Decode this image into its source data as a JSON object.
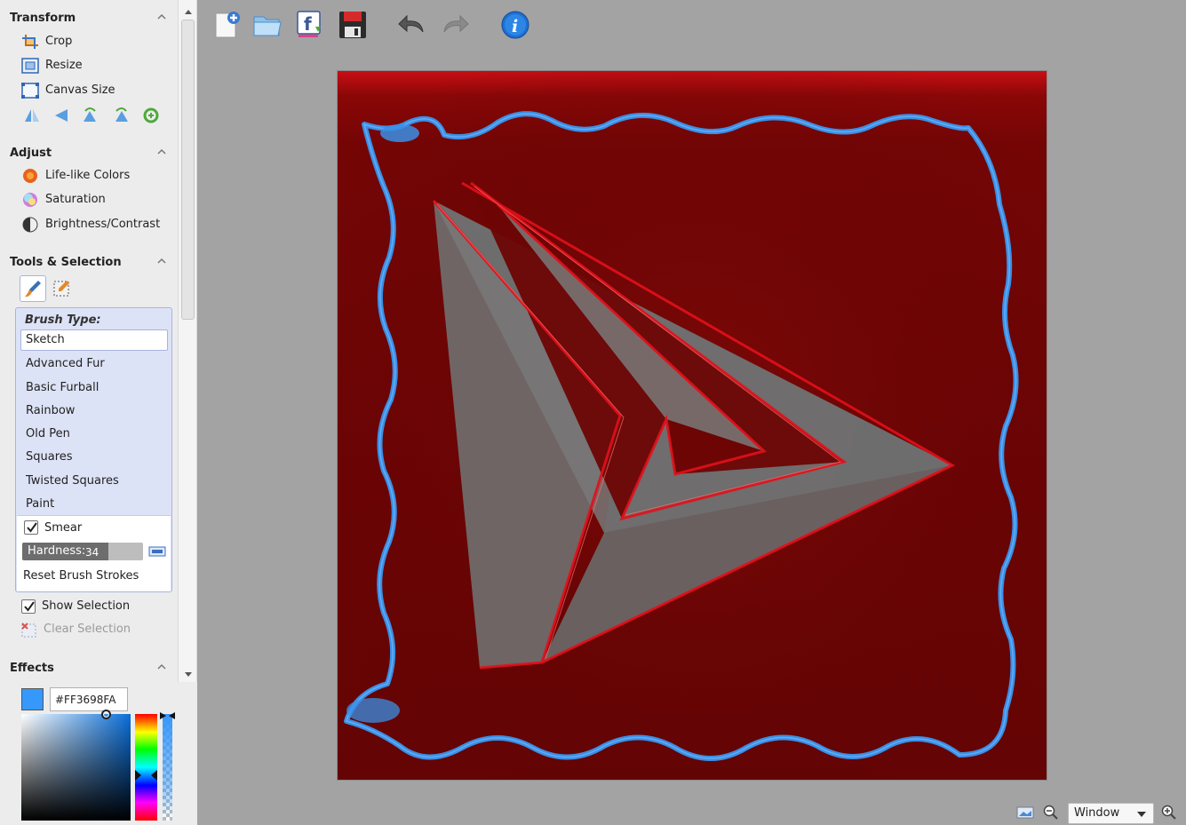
{
  "sidebar": {
    "transform": {
      "title": "Transform",
      "items": [
        {
          "label": "Crop",
          "icon": "crop-icon"
        },
        {
          "label": "Resize",
          "icon": "resize-icon"
        },
        {
          "label": "Canvas Size",
          "icon": "canvas-size-icon"
        }
      ],
      "tools": [
        "flip-vertical-icon",
        "flip-horizontal-icon",
        "rotate-left-icon",
        "rotate-right-icon",
        "rotate-free-icon"
      ]
    },
    "adjust": {
      "title": "Adjust",
      "items": [
        {
          "label": "Life-like Colors",
          "icon": "life-like-colors-icon"
        },
        {
          "label": "Saturation",
          "icon": "saturation-icon"
        },
        {
          "label": "Brightness/Contrast",
          "icon": "brightness-contrast-icon"
        }
      ]
    },
    "tools": {
      "title": "Tools & Selection",
      "tabs": [
        "brush-tool-icon",
        "selection-tool-icon"
      ],
      "brush_type_label": "Brush Type:",
      "brush_types": [
        "Sketch",
        "Advanced Fur",
        "Basic Furball",
        "Rainbow",
        "Old Pen",
        "Squares",
        "Twisted Squares",
        "Paint"
      ],
      "selected_brush": "Sketch",
      "smear": {
        "label": "Smear",
        "checked": true
      },
      "hardness": {
        "label": "Hardness:",
        "value": "34",
        "fraction": 0.34
      },
      "reset_label": "Reset Brush Strokes",
      "show_selection": {
        "label": "Show Selection",
        "checked": true
      },
      "clear_selection_label": "Clear Selection"
    },
    "effects": {
      "title": "Effects"
    },
    "color": {
      "hex": "#FF3698FA",
      "swatch": "#3698fa"
    }
  },
  "toolbar": {
    "buttons": [
      "new-image-icon",
      "open-folder-icon",
      "facebook-upload-icon",
      "save-icon",
      "undo-icon",
      "redo-icon",
      "info-icon"
    ]
  },
  "statusbar": {
    "zoom_mode": "Window"
  },
  "colors": {
    "canvas_bg": "#6d0505",
    "accent_blue": "#3698fa",
    "stroke_red": "#e3101a",
    "shape_gray": "#7a7a7a"
  }
}
